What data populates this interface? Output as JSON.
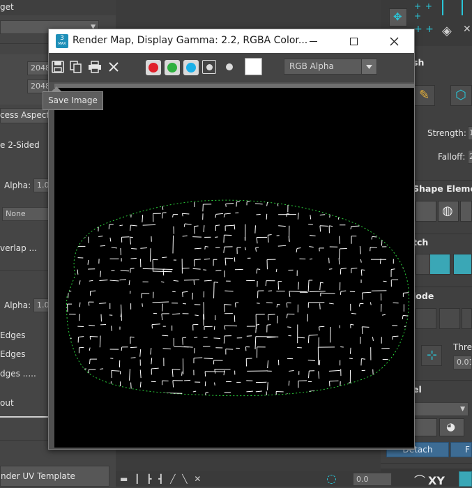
{
  "left_panel": {
    "title_fragment": "get",
    "width_value": "2048",
    "height_value": "2048",
    "aspect_label": "cess Aspect R",
    "two_sided_label": "e 2-Sided",
    "alpha_label_1": "Alpha:",
    "alpha_value_1": "1.0",
    "fill_select_value": "None",
    "overlap_label": "verlap ...",
    "alpha_label_2": "Alpha:",
    "alpha_value_2": "1.0",
    "edges_label_1": "Edges",
    "edges_label_2": "Edges",
    "edges_label_3": "dges .....",
    "output_label": "out",
    "render_button_label": "nder UV Template"
  },
  "render_window": {
    "title": "Render Map, Display Gamma: 2.2, RGBA Color...",
    "app_icon_text": "3",
    "app_icon_sub": "MAX",
    "channel_select_value": "RGB Alpha",
    "tooltip": "Save Image",
    "colors": {
      "red": "#e0202a",
      "green": "#2fb040",
      "blue": "#1ab0e8",
      "uv_wire": "#ffffff",
      "uv_border": "#2ad13a"
    }
  },
  "right_panel": {
    "brush_header": "sh",
    "strength_label": "Strength:",
    "strength_value": "1",
    "falloff_label": "Falloff:",
    "falloff_value": "2",
    "shape_header": "Shape Elemen",
    "stitch_header": "tch",
    "mode_header": "lode",
    "threshold_label": "Thre",
    "threshold_value": "0.01",
    "el_header": "el",
    "detach_button": "Detach",
    "second_button": "F"
  },
  "bottom_bar": {
    "value": "0.0",
    "xy_label": "XY"
  }
}
